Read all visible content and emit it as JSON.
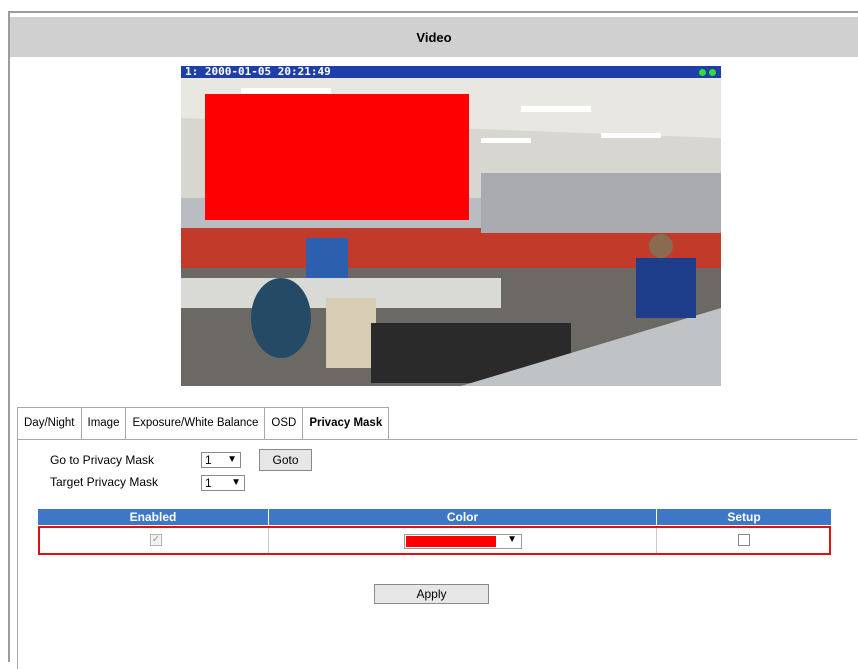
{
  "title": "Video",
  "video": {
    "overlay": "1:  2000-01-05 20:21:49"
  },
  "tabs": [
    "Day/Night",
    "Image",
    "Exposure/White Balance",
    "OSD",
    "Privacy Mask"
  ],
  "active_tab": "Privacy Mask",
  "form": {
    "goto_label": "Go to Privacy Mask",
    "goto_value": "1",
    "goto_button": "Goto",
    "target_label": "Target Privacy Mask",
    "target_value": "1"
  },
  "table": {
    "headers": [
      "Enabled",
      "Color",
      "Setup"
    ],
    "row": {
      "enabled": true,
      "color": "#ff0000",
      "setup": false
    }
  },
  "apply_button": "Apply",
  "colors": {
    "header": "#3d77c6",
    "title_bar": "#d0d0d0",
    "highlight": "#e01010",
    "mask": "#ff0000"
  }
}
